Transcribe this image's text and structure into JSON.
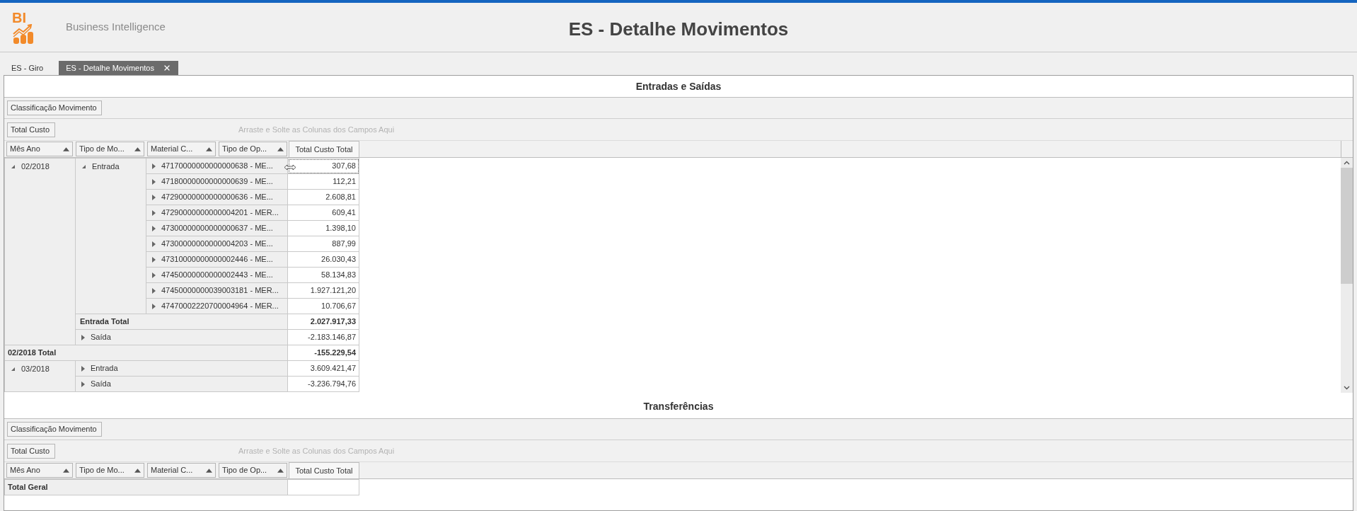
{
  "header": {
    "logo_text": "BI",
    "subtitle": "Business Intelligence",
    "title": "ES - Detalhe Movimentos"
  },
  "tabs": [
    {
      "label": "ES - Giro",
      "selected": false
    },
    {
      "label": "ES - Detalhe Movimentos",
      "selected": true
    }
  ],
  "sections": [
    {
      "title": "Entradas e Saídas",
      "filter_fields": [
        "Classificação Movimento"
      ],
      "data_fields": [
        "Total Custo"
      ],
      "drop_hint": "Arraste e Solte as Colunas dos Campos Aqui",
      "row_fields": [
        {
          "label": "Mês Ano"
        },
        {
          "label": "Tipo de Mo..."
        },
        {
          "label": "Material C..."
        },
        {
          "label": "Tipo de Op..."
        }
      ],
      "value_header": "Total Custo Total",
      "scrollbar": true,
      "months": [
        {
          "label": "02/2018",
          "expanded": true,
          "types": [
            {
              "label": "Entrada",
              "expanded": true,
              "materials": [
                {
                  "label": "47170000000000000638 - ME...",
                  "value": "307,68",
                  "focused": true
                },
                {
                  "label": "47180000000000000639 - ME...",
                  "value": "112,21",
                  "focused": false
                },
                {
                  "label": "47290000000000000636 - ME...",
                  "value": "2.608,81",
                  "focused": false
                },
                {
                  "label": "47290000000000004201 - MER...",
                  "value": "609,41",
                  "focused": false
                },
                {
                  "label": "47300000000000000637 - ME...",
                  "value": "1.398,10",
                  "focused": false
                },
                {
                  "label": "47300000000000004203 - ME...",
                  "value": "887,99",
                  "focused": false
                },
                {
                  "label": "47310000000000002446 - ME...",
                  "value": "26.030,43",
                  "focused": false
                },
                {
                  "label": "47450000000000002443 - ME...",
                  "value": "58.134,83",
                  "focused": false
                },
                {
                  "label": "47450000000039003181 - MER...",
                  "value": "1.927.121,20",
                  "focused": false
                },
                {
                  "label": "47470002220700004964 - MER...",
                  "value": "10.706,67",
                  "focused": false
                }
              ],
              "total_label": "Entrada Total",
              "total_value": "2.027.917,33"
            },
            {
              "label": "Saída",
              "expanded": false,
              "value": "-2.183.146,87"
            }
          ],
          "total_label": "02/2018 Total",
          "total_value": "-155.229,54"
        },
        {
          "label": "03/2018",
          "expanded": true,
          "types": [
            {
              "label": "Entrada",
              "expanded": false,
              "value": "3.609.421,47"
            },
            {
              "label": "Saída",
              "expanded": false,
              "value": "-3.236.794,76"
            }
          ]
        }
      ]
    },
    {
      "title": "Transferências",
      "filter_fields": [
        "Classificação Movimento"
      ],
      "data_fields": [
        "Total Custo"
      ],
      "drop_hint": "Arraste e Solte as Colunas dos Campos Aqui",
      "row_fields": [
        {
          "label": "Mês Ano"
        },
        {
          "label": "Tipo de Mo..."
        },
        {
          "label": "Material C..."
        },
        {
          "label": "Tipo de Op..."
        }
      ],
      "value_header": "Total Custo Total",
      "scrollbar": false,
      "grand_total_label": "Total Geral"
    }
  ]
}
